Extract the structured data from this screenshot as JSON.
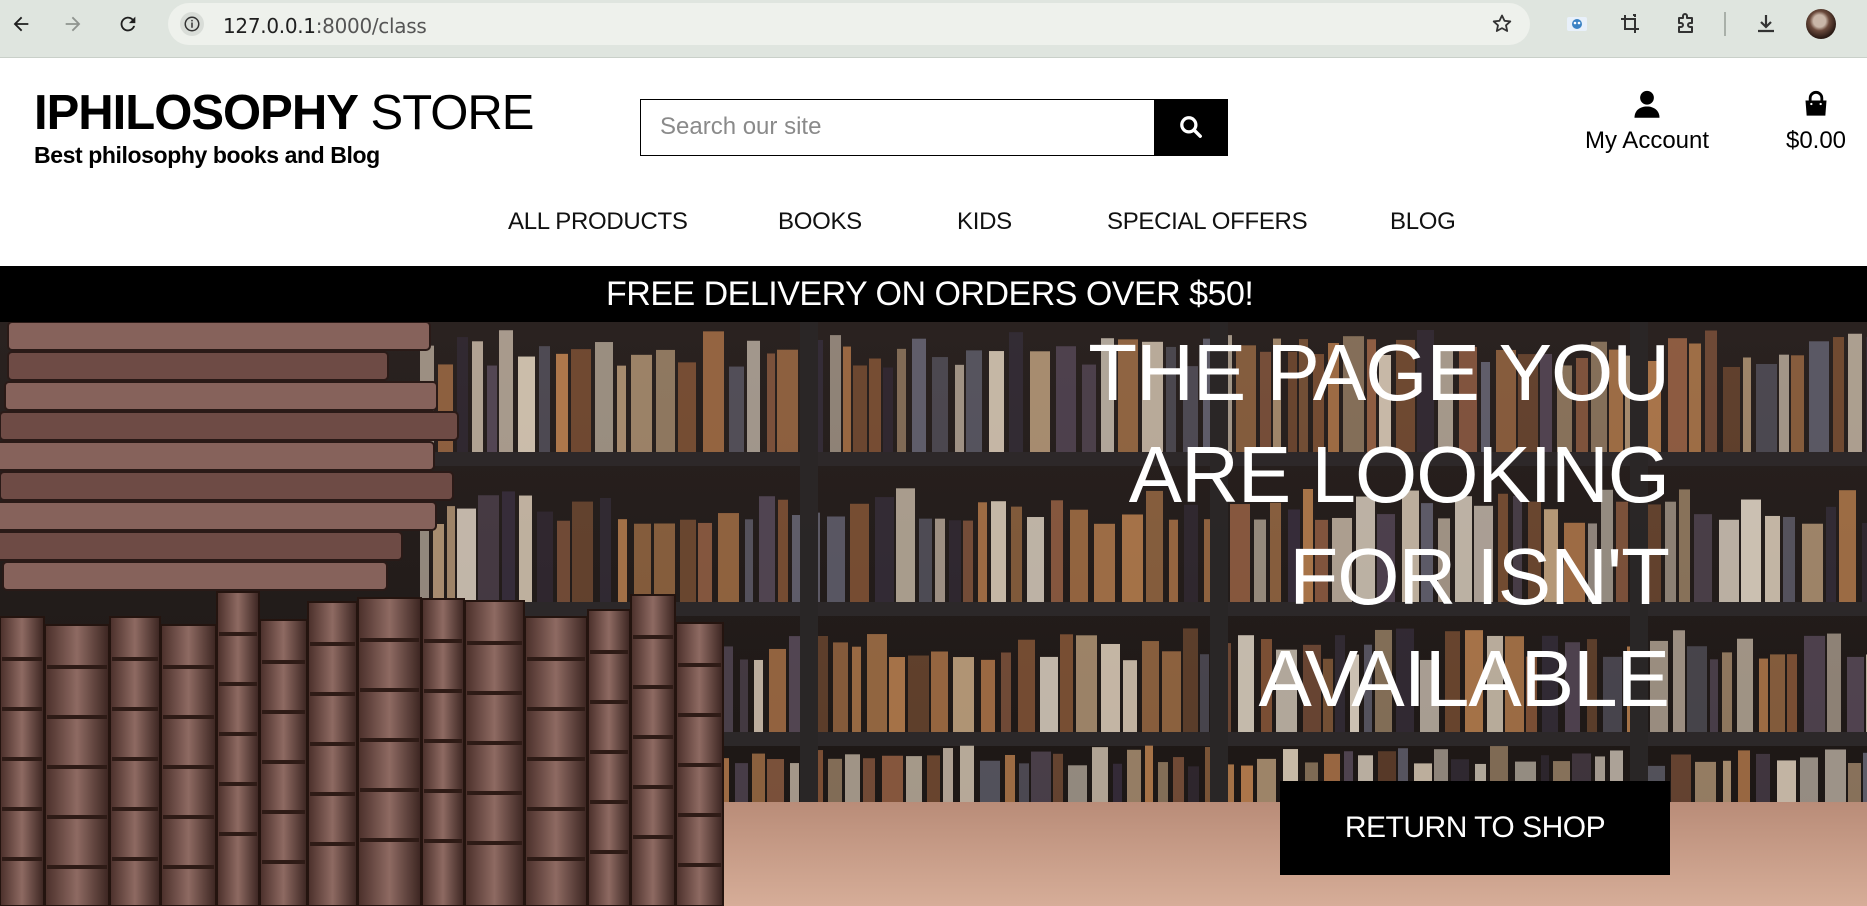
{
  "browser": {
    "url_host": "127.0.0.1",
    "url_path": ":8000/class"
  },
  "site": {
    "brand_bold": "IPHILOSOPHY",
    "brand_light": "STORE",
    "tagline": "Best philosophy books and Blog"
  },
  "search": {
    "placeholder": "Search our site"
  },
  "account": {
    "label": "My Account"
  },
  "bag": {
    "total": "$0.00"
  },
  "nav": {
    "items": [
      {
        "label": "ALL PRODUCTS"
      },
      {
        "label": "BOOKS"
      },
      {
        "label": "KIDS"
      },
      {
        "label": "SPECIAL OFFERS"
      },
      {
        "label": "BLOG"
      }
    ]
  },
  "banner": {
    "text": "FREE DELIVERY ON ORDERS OVER $50!"
  },
  "hero": {
    "title_lines": [
      "THE PAGE YOU",
      "ARE LOOKING",
      "FOR ISN'T",
      "AVAILABLE"
    ],
    "cta_label": "RETURN TO SHOP"
  }
}
